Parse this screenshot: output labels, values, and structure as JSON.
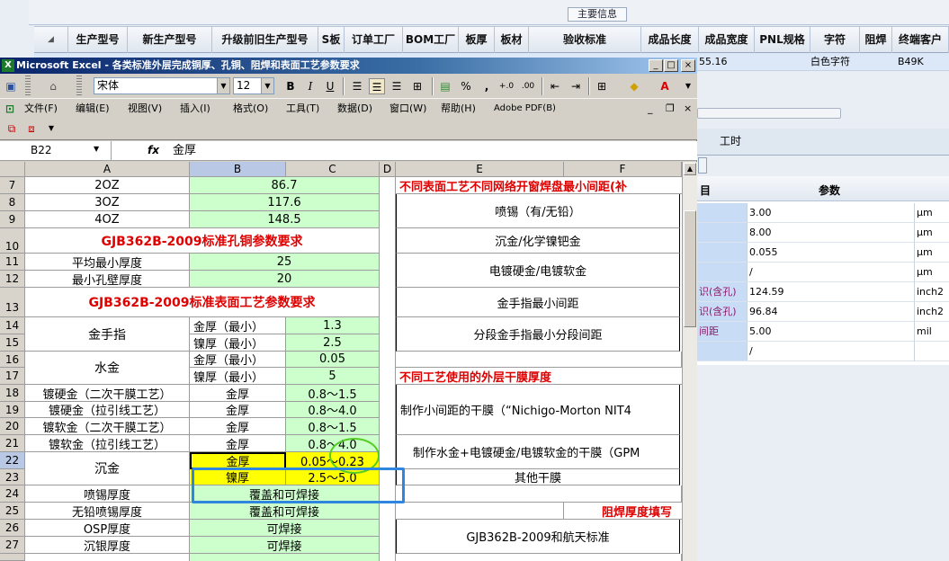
{
  "bg": {
    "group_label": "主要信息",
    "columns": [
      "生产型号",
      "新生产型号",
      "升级前旧生产型号",
      "S板",
      "订单工厂",
      "BOM工厂",
      "板厚",
      "板材",
      "验收标准",
      "成品长度",
      "成品宽度",
      "PNL规格",
      "字符",
      "阻焊",
      "终端客户"
    ],
    "row": {
      "width": "55.16",
      "char": "白色字符",
      "customer": "B49K"
    },
    "tab_label": "工时",
    "params_header": "参数",
    "params_header_left": "目",
    "params": [
      {
        "name": "",
        "value": "3.00",
        "unit": "μm"
      },
      {
        "name": "",
        "value": "8.00",
        "unit": "μm"
      },
      {
        "name": "",
        "value": "0.055",
        "unit": "μm"
      },
      {
        "name": "",
        "value": "/",
        "unit": "μm"
      },
      {
        "name": "识(含孔)",
        "value": "124.59",
        "unit": "inch2"
      },
      {
        "name": "识(含孔)",
        "value": "96.84",
        "unit": "inch2"
      },
      {
        "name": "间距",
        "value": "5.00",
        "unit": "mil"
      },
      {
        "name": "",
        "value": "/",
        "unit": ""
      }
    ]
  },
  "excel": {
    "title": "Microsoft Excel - 各类标准外层完成铜厚、孔铜、阻焊和表面工艺参数要求",
    "font_name": "宋体",
    "font_size": "12",
    "menu": [
      "文件(F)",
      "编辑(E)",
      "视图(V)",
      "插入(I)",
      "格式(O)",
      "工具(T)",
      "数据(D)",
      "窗口(W)",
      "帮助(H)",
      "Adobe PDF(B)"
    ],
    "name_box": "B22",
    "fx": "fx",
    "formula": "金厚",
    "col_headers": [
      "A",
      "B",
      "C",
      "D",
      "E",
      "F"
    ],
    "rows": [
      {
        "n": "7"
      },
      {
        "n": "8"
      },
      {
        "n": "9"
      },
      {
        "n": "10"
      },
      {
        "n": "11"
      },
      {
        "n": "12"
      },
      {
        "n": "13"
      },
      {
        "n": "14"
      },
      {
        "n": "15"
      },
      {
        "n": "16"
      },
      {
        "n": "17"
      },
      {
        "n": "18"
      },
      {
        "n": "19"
      },
      {
        "n": "20"
      },
      {
        "n": "21"
      },
      {
        "n": "22"
      },
      {
        "n": "23"
      },
      {
        "n": "24"
      },
      {
        "n": "25"
      },
      {
        "n": "26"
      },
      {
        "n": "27"
      }
    ],
    "cells": {
      "a7": "2OZ",
      "bc7": "86.7",
      "a8": "3OZ",
      "bc8": "117.6",
      "a9": "4OZ",
      "bc9": "148.5",
      "h10": "GJB362B-2009标准孔铜参数要求",
      "a11": "平均最小厚度",
      "bc11": "25",
      "a12": "最小孔壁厚度",
      "bc12": "20",
      "h13": "GJB362B-2009标准表面工艺参数要求",
      "a14": "金手指",
      "b14": "金厚（最小）",
      "c14": "1.3",
      "b15": "镍厚（最小）",
      "c15": "2.5",
      "a16": "水金",
      "b16": "金厚（最小）",
      "c16": "0.05",
      "b17": "镍厚（最小）",
      "c17": "5",
      "a18": "镀硬金（二次干膜工艺）",
      "b18": "金厚",
      "c18": "0.8～1.5",
      "a19": "镀硬金（拉引线工艺）",
      "b19": "金厚",
      "c19": "0.8～4.0",
      "a20": "镀软金（二次干膜工艺）",
      "b20": "金厚",
      "c20": "0.8～1.5",
      "a21": "镀软金（拉引线工艺）",
      "b21": "金厚",
      "c21": "0.8～4.0",
      "a22": "沉金",
      "b22": "金厚",
      "c22": "0.05～0.23",
      "b23": "镍厚",
      "c23": "2.5～5.0",
      "a24": "喷锡厚度",
      "bc24": "覆盖和可焊接",
      "a25": "无铅喷锡厚度",
      "bc25": "覆盖和可焊接",
      "a26": "OSP厚度",
      "bc26": "可焊接",
      "a27": "沉银厚度",
      "bc27": "可焊接",
      "e7": "不同表面工艺不同网络开窗焊盘最小间距(补",
      "e8": "喷锡（有/无铅）",
      "e10": "沉金/化学镍钯金",
      "e11": "电镀硬金/电镀软金",
      "e13": "金手指最小间距",
      "e14": "分段金手指最小分段间距",
      "e17": "不同工艺使用的外层干膜厚度",
      "e18": "制作小间距的干膜（“Nichigo-Morton NIT4",
      "e21": "制作水金+电镀硬金/电镀软金的干膜（GPM",
      "e23": "其他干膜",
      "f25": "阻焊厚度填写",
      "e26": "GJB362B-2009和航天标准"
    }
  }
}
